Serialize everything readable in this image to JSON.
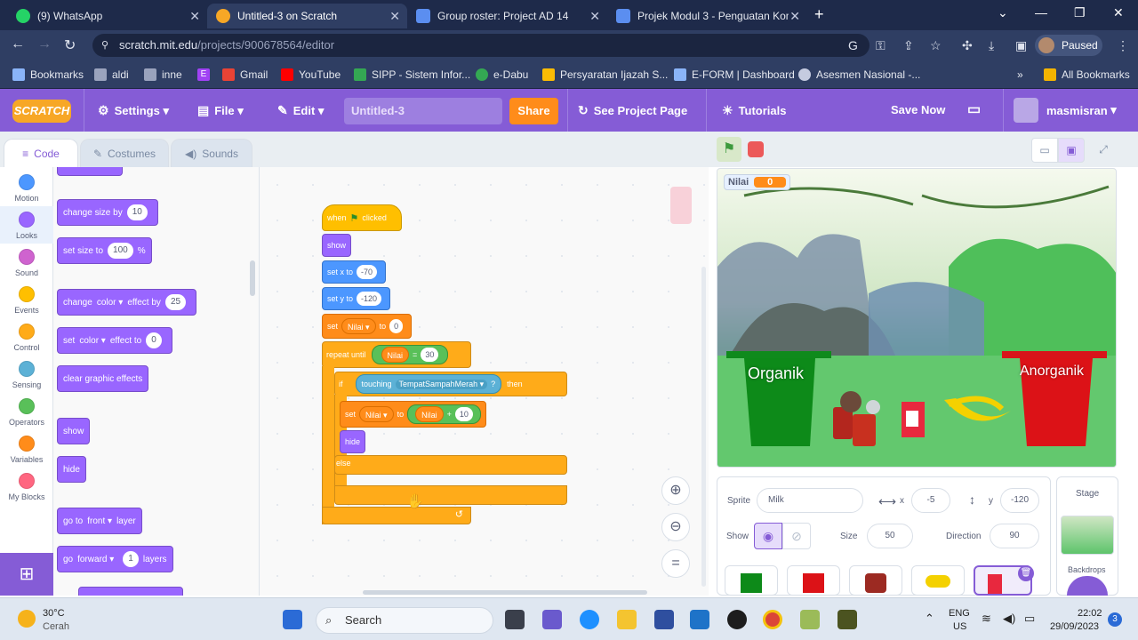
{
  "browser": {
    "tabs": [
      {
        "title": "(9) WhatsApp",
        "active": false
      },
      {
        "title": "Untitled-3 on Scratch",
        "active": true
      },
      {
        "title": "Group roster: Project AD 14",
        "active": false
      },
      {
        "title": "Projek Modul 3 - Penguatan Kom",
        "active": false
      }
    ],
    "url_host": "scratch.mit.edu",
    "url_path": "/projects/900678564/editor",
    "profile_status": "Paused",
    "bookmarks": [
      "Bookmarks",
      "aldi",
      "inne",
      "E",
      "Gmail",
      "YouTube",
      "SIPP - Sistem Infor...",
      "e-Dabu",
      "Persyaratan Ijazah S...",
      "E-FORM | Dashboard",
      "Asesmen Nasional -...",
      "All Bookmarks"
    ]
  },
  "menubar": {
    "logo": "SCRATCH",
    "settings": "Settings",
    "file": "File",
    "edit": "Edit",
    "project_title": "Untitled-3",
    "share": "Share",
    "see_project_page": "See Project Page",
    "tutorials": "Tutorials",
    "save_now": "Save Now",
    "username": "masmisran"
  },
  "editor_tabs": {
    "code": "Code",
    "costumes": "Costumes",
    "sounds": "Sounds"
  },
  "categories": [
    "Motion",
    "Looks",
    "Sound",
    "Events",
    "Control",
    "Sensing",
    "Operators",
    "Variables",
    "My Blocks"
  ],
  "category_colors": [
    "#4c97ff",
    "#9966ff",
    "#cf63cf",
    "#ffbf00",
    "#ffab19",
    "#5cb1d6",
    "#59c059",
    "#ff8c1a",
    "#ff6680"
  ],
  "palette": {
    "change_size_by": "change size by",
    "change_size_value": "10",
    "set_size_to": "set size to",
    "set_size_value": "100",
    "set_size_unit": "%",
    "change_effect": "change",
    "effect_name": "color",
    "effect_by": "effect by",
    "change_effect_value": "25",
    "set_effect": "set",
    "effect_to": "effect to",
    "set_effect_value": "0",
    "clear_effects": "clear graphic effects",
    "show": "show",
    "hide": "hide",
    "go_to": "go to",
    "front": "front",
    "layer": "layer",
    "go": "go",
    "forward": "forward",
    "layers_value": "1",
    "layers": "layers"
  },
  "script": {
    "when": "when",
    "clicked": "clicked",
    "show": "show",
    "set_x": "set x to",
    "x_value": "-70",
    "set_y": "set y to",
    "y_value": "-120",
    "set": "set",
    "var_name": "Nilai",
    "to": "to",
    "set_value": "0",
    "repeat_until": "repeat until",
    "equals": "=",
    "target": "30",
    "if": "if",
    "touching": "touching",
    "touch_target": "TempatSampahMerah",
    "question": "?",
    "then": "then",
    "plus": "+",
    "add_value": "10",
    "hide": "hide",
    "else": "else"
  },
  "stage": {
    "monitor_label": "Nilai",
    "monitor_value": "0",
    "bin_left": "Organik",
    "bin_right": "Anorganik"
  },
  "sprite_info": {
    "sprite_label": "Sprite",
    "sprite_name": "Milk",
    "x_label": "x",
    "x_value": "-5",
    "y_label": "y",
    "y_value": "-120",
    "show_label": "Show",
    "size_label": "Size",
    "size_value": "50",
    "direction_label": "Direction",
    "direction_value": "90",
    "stage_label": "Stage",
    "backdrops_label": "Backdrops"
  },
  "taskbar": {
    "temperature": "30°C",
    "weather": "Cerah",
    "search": "Search",
    "lang": "ENG",
    "region": "US",
    "time": "22:02",
    "date": "29/09/2023",
    "notifications": "3"
  }
}
